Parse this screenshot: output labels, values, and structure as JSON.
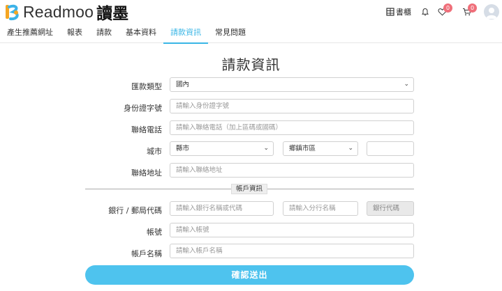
{
  "header": {
    "logo_text": "Readmoo",
    "logo_cn": "讀墨",
    "bookshelf_label": "書櫃",
    "wishlist_count": "0",
    "cart_count": "0",
    "brand_color": "#f5a623",
    "accent_color": "#39b6e6"
  },
  "tabs": [
    {
      "label": "產生推薦網址"
    },
    {
      "label": "報表"
    },
    {
      "label": "請款"
    },
    {
      "label": "基本資料"
    },
    {
      "label": "請款資訊"
    },
    {
      "label": "常見問題"
    }
  ],
  "form": {
    "title": "請款資訊",
    "remit_type": {
      "label": "匯款類型",
      "value": "國內"
    },
    "id_number": {
      "label": "身份證字號",
      "placeholder": "請輸入身份證字號"
    },
    "phone": {
      "label": "聯絡電話",
      "placeholder": "請輸入聯絡電話（加上區碼或國碼）"
    },
    "city": {
      "label": "城市",
      "county_value": "縣市",
      "district_value": "鄉鎮市區",
      "zip_value": ""
    },
    "address": {
      "label": "聯絡地址",
      "placeholder": "請輸入聯絡地址"
    },
    "account_section_label": "帳戶資訊",
    "bank": {
      "label": "銀行 / 郵局代碼",
      "bank_placeholder": "請輸入銀行名稱或代碼",
      "branch_placeholder": "請輸入分行名稱",
      "code_placeholder": "銀行代碼"
    },
    "account_number": {
      "label": "帳號",
      "placeholder": "請輸入帳號"
    },
    "account_name": {
      "label": "帳戶名稱",
      "placeholder": "請輸入帳戶名稱"
    },
    "submit_label": "確認送出"
  }
}
